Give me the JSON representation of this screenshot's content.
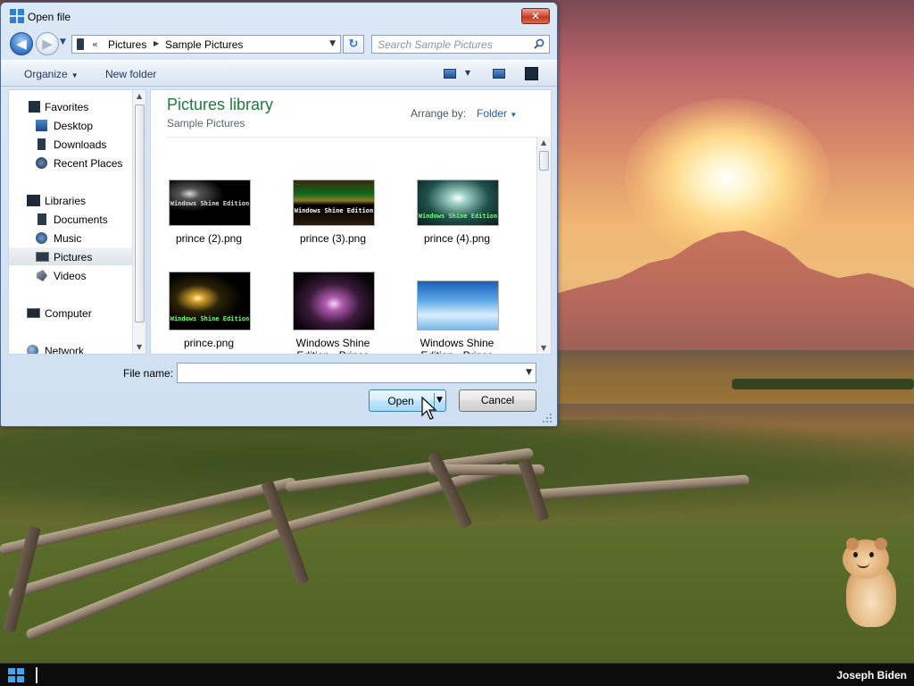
{
  "dialog": {
    "title": "Open file",
    "close_symbol": "✕"
  },
  "navbar": {
    "address_overflow": "«",
    "breadcrumbs": [
      "Pictures",
      "Sample Pictures"
    ],
    "search_placeholder": "Search Sample Pictures"
  },
  "commands": {
    "organize": "Organize",
    "new_folder": "New folder"
  },
  "nav_pane": {
    "items": [
      {
        "label": "Favorites",
        "icon": "favorites-icon",
        "selected": false
      },
      {
        "label": "Desktop",
        "icon": "desktop-icon",
        "selected": false
      },
      {
        "label": "Downloads",
        "icon": "downloads-icon",
        "selected": false
      },
      {
        "label": "Recent Places",
        "icon": "recent-places-icon",
        "selected": false
      },
      {
        "label": "Libraries",
        "icon": "libraries-icon",
        "selected": false
      },
      {
        "label": "Documents",
        "icon": "documents-icon",
        "selected": false
      },
      {
        "label": "Music",
        "icon": "music-icon",
        "selected": false
      },
      {
        "label": "Pictures",
        "icon": "pictures-icon",
        "selected": true
      },
      {
        "label": "Videos",
        "icon": "videos-icon",
        "selected": false
      },
      {
        "label": "Computer",
        "icon": "computer-icon",
        "selected": false
      },
      {
        "label": "Network",
        "icon": "network-icon",
        "selected": false
      }
    ]
  },
  "content": {
    "library_title": "Pictures library",
    "library_subtitle": "Sample Pictures",
    "arrange_by_label": "Arrange by:",
    "arrange_by_value": "Folder",
    "files": [
      {
        "name": "prince (2).png",
        "thumb_text": "Windows Shine Edition"
      },
      {
        "name": "prince (3).png",
        "thumb_text": "Windows Shine Edition"
      },
      {
        "name": "prince (4).png",
        "thumb_text": "Windows Shine Edition"
      },
      {
        "name": "prince.png",
        "thumb_text": "Windows Shine Edition"
      },
      {
        "name": "Windows Shine Edition - Prince",
        "thumb_text": ""
      },
      {
        "name": "Windows Shine Edition - Prince",
        "thumb_text": ""
      }
    ]
  },
  "footer": {
    "file_name_label": "File name:",
    "file_name_value": "",
    "open_label": "Open",
    "cancel_label": "Cancel"
  },
  "taskbar": {
    "user_name": "Joseph Biden"
  },
  "colors": {
    "library_title": "#1f7a3a",
    "link_blue": "#1c5fb4",
    "taskbar": "#0c0c0c"
  }
}
